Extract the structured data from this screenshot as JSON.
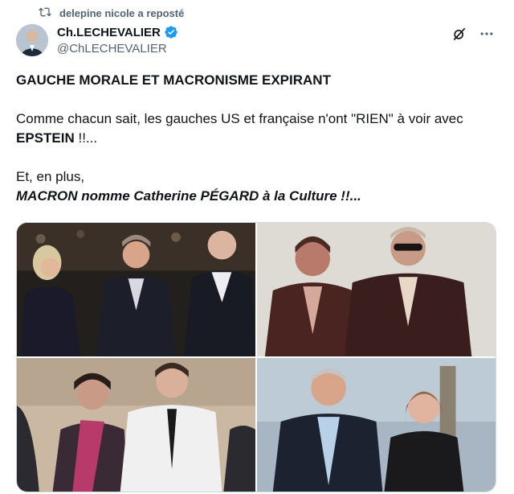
{
  "repost": {
    "label": "delepine nicole a reposté",
    "icon": "repost-icon"
  },
  "author": {
    "display_name": "Ch.LECHEVALIER",
    "handle": "@ChLECHEVALIER",
    "verified": true,
    "verified_color": "#1d9bf0"
  },
  "tweet": {
    "headline": "GAUCHE MORALE ET MACRONISME EXPIRANT",
    "line1": "Comme chacun sait, les gauches US et française n'ont \"RIEN\" à voir avec",
    "line1_bold": "EPSTEIN",
    "line1_end": " !!...",
    "line2": "Et, en plus,",
    "line3": "MACRON nomme Catherine PÉGARD à la Culture !!..."
  },
  "media": {
    "count": 4,
    "images": [
      "photo-1",
      "photo-2",
      "photo-3",
      "photo-4"
    ]
  },
  "colors": {
    "text": "#0f1419",
    "secondary": "#536471",
    "border": "#cfd9de"
  }
}
